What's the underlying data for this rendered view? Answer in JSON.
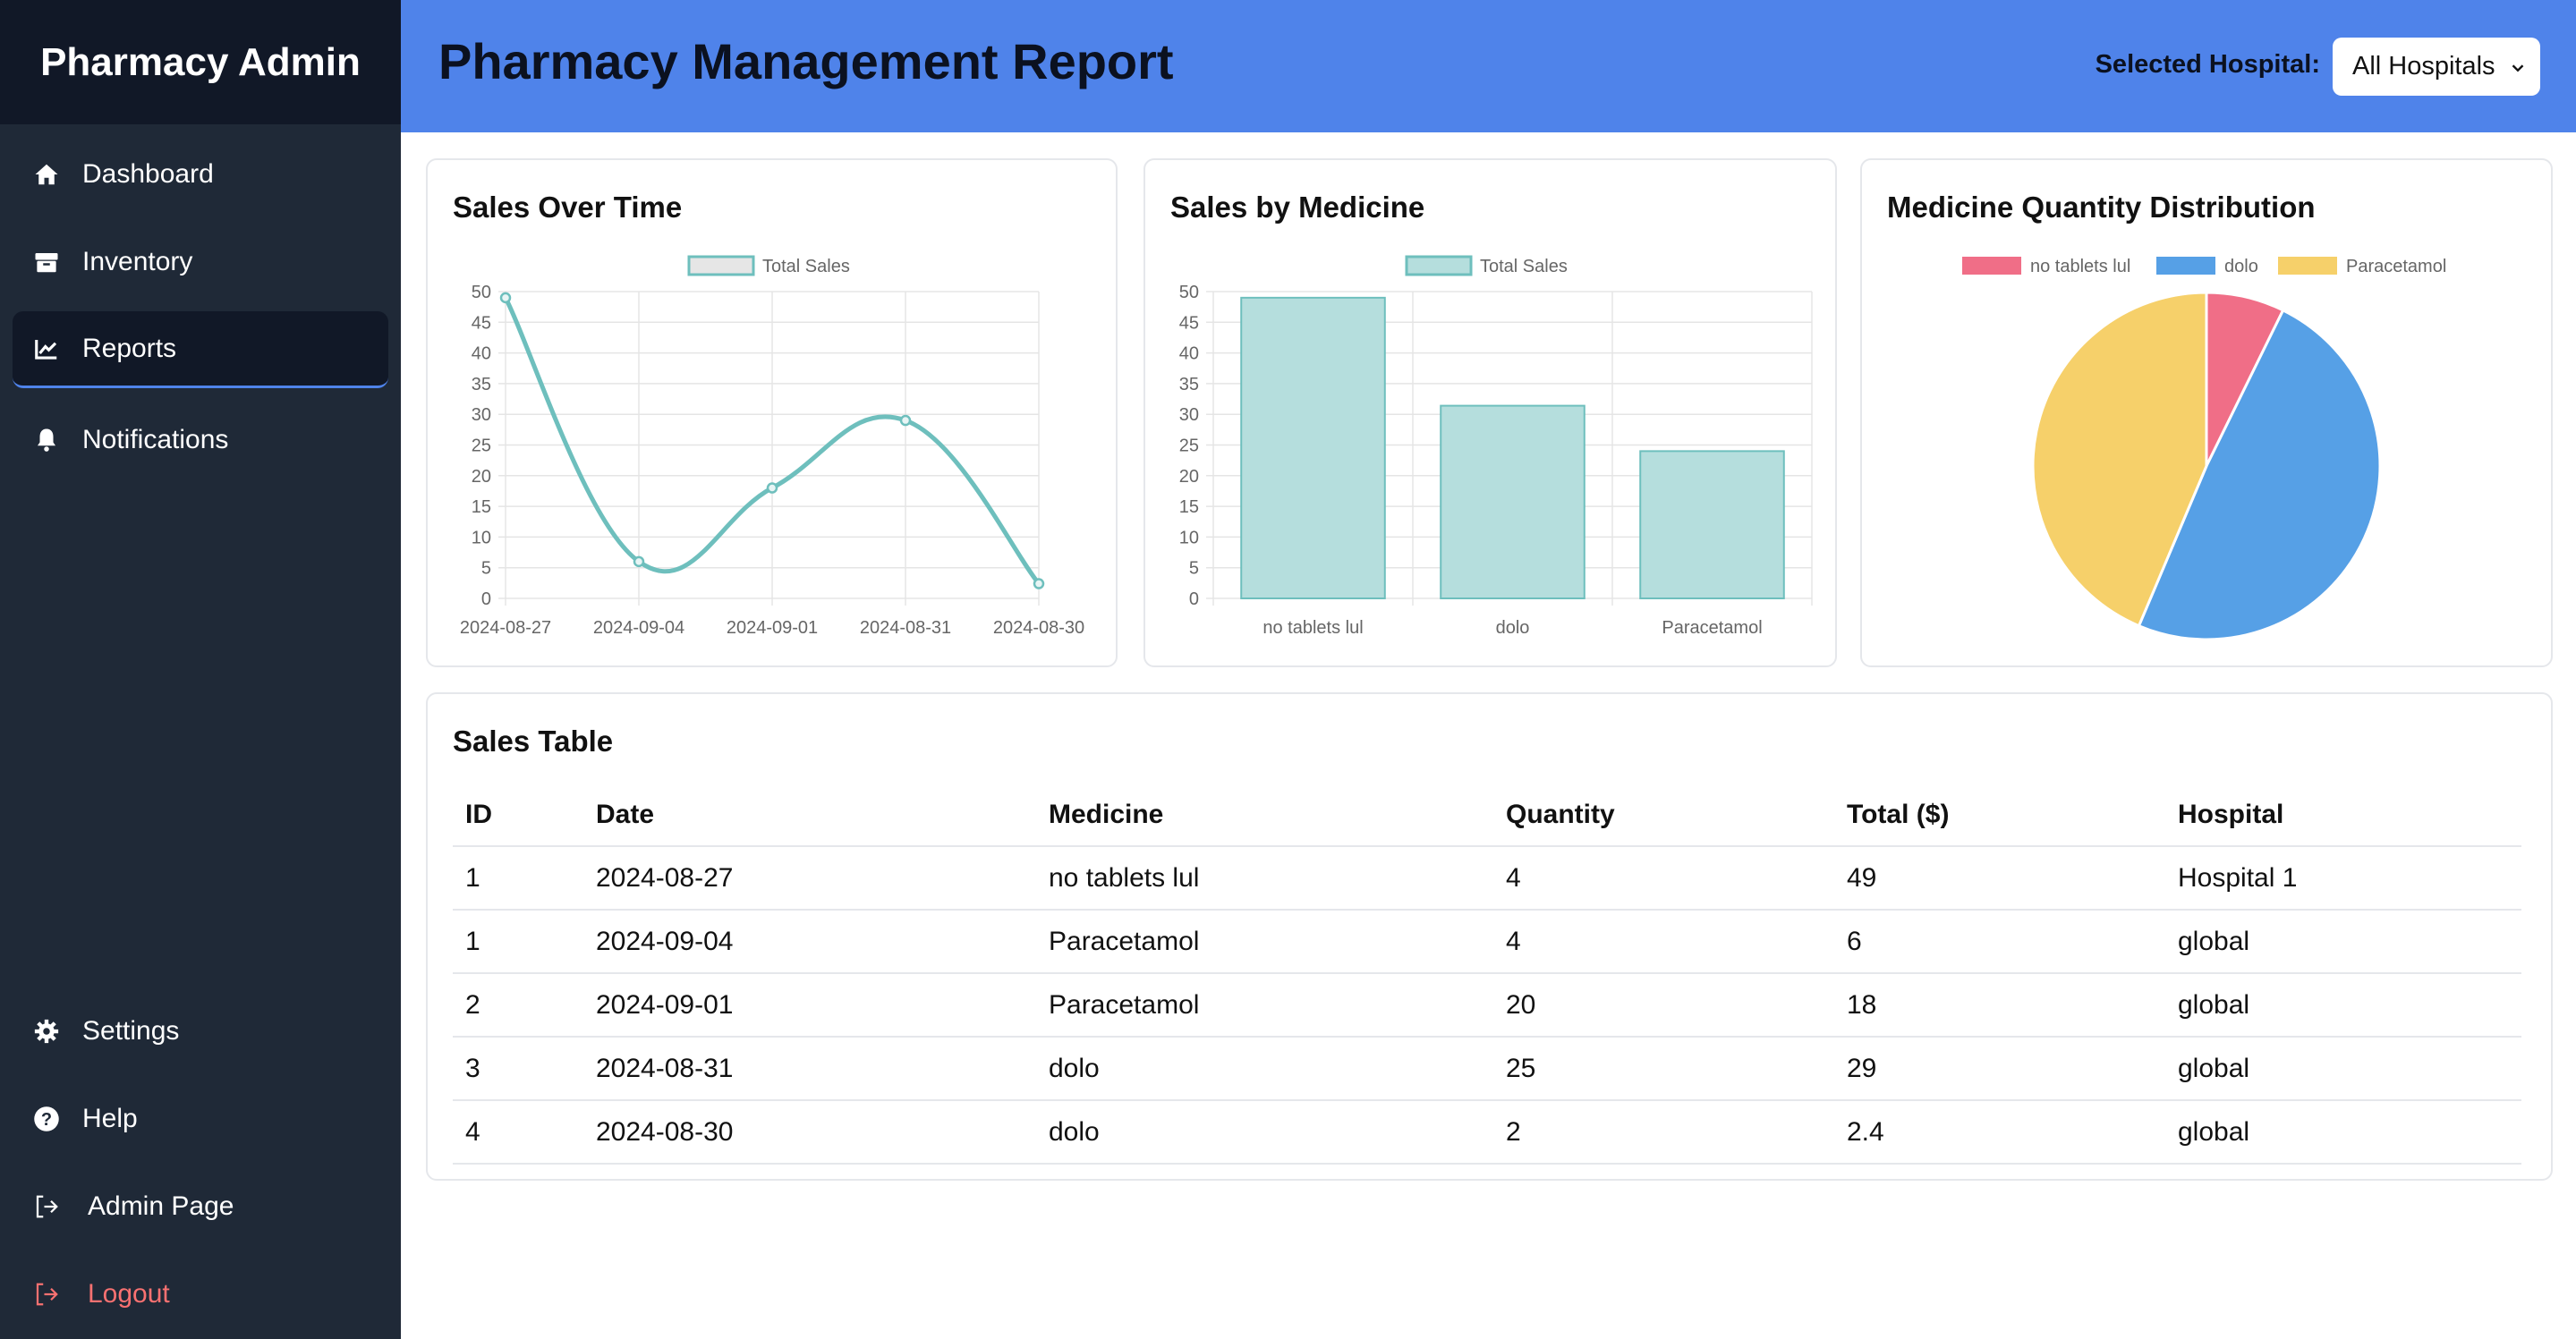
{
  "sidebar": {
    "brand": "Pharmacy Admin",
    "items": [
      {
        "label": "Dashboard",
        "icon": "home-icon"
      },
      {
        "label": "Inventory",
        "icon": "box-icon"
      },
      {
        "label": "Reports",
        "icon": "chart-line-icon",
        "active": true
      },
      {
        "label": "Notifications",
        "icon": "bell-icon"
      }
    ],
    "bottom_items": [
      {
        "label": "Settings",
        "icon": "gear-icon"
      },
      {
        "label": "Help",
        "icon": "question-icon"
      },
      {
        "label": "Admin Page",
        "icon": "sign-in-icon"
      },
      {
        "label": "Logout",
        "icon": "sign-out-icon"
      }
    ]
  },
  "header": {
    "title": "Pharmacy Management Report",
    "hospital_label": "Selected Hospital:",
    "hospital_value": "All Hospitals"
  },
  "colors": {
    "header_bg": "#4f83ea",
    "sidebar_bg": "#1f2937",
    "teal": "#6ebfbd",
    "pie_red": "#f06e87",
    "pie_blue": "#56a0e6",
    "pie_yellow": "#f6d06a",
    "logout": "#f87171"
  },
  "cards": {
    "sales_over_time": "Sales Over Time",
    "sales_by_medicine": "Sales by Medicine",
    "quantity_distribution": "Medicine Quantity Distribution",
    "sales_table": "Sales Table"
  },
  "chart_data": [
    {
      "type": "line",
      "title": "Sales Over Time",
      "categories": [
        "2024-08-27",
        "2024-09-04",
        "2024-09-01",
        "2024-08-31",
        "2024-08-30"
      ],
      "series": [
        {
          "name": "Total Sales",
          "values": [
            49,
            6,
            18,
            29,
            2.4
          ]
        }
      ],
      "ylim": [
        0,
        50
      ],
      "yticks": [
        0,
        5,
        10,
        15,
        20,
        25,
        30,
        35,
        40,
        45,
        50
      ],
      "grid": true,
      "legend": "top-center"
    },
    {
      "type": "bar",
      "title": "Sales by Medicine",
      "categories": [
        "no tablets lul",
        "dolo",
        "Paracetamol"
      ],
      "series": [
        {
          "name": "Total Sales",
          "values": [
            49,
            31.4,
            24
          ]
        }
      ],
      "ylim": [
        0,
        50
      ],
      "yticks": [
        0,
        5,
        10,
        15,
        20,
        25,
        30,
        35,
        40,
        45,
        50
      ],
      "grid": true,
      "legend": "top-center"
    },
    {
      "type": "pie",
      "title": "Medicine Quantity Distribution",
      "categories": [
        "no tablets lul",
        "dolo",
        "Paracetamol"
      ],
      "values": [
        4,
        27,
        24
      ],
      "legend": "top-center"
    }
  ],
  "table": {
    "columns": [
      "ID",
      "Date",
      "Medicine",
      "Quantity",
      "Total ($)",
      "Hospital"
    ],
    "rows": [
      [
        "1",
        "2024-08-27",
        "no tablets lul",
        "4",
        "49",
        "Hospital 1"
      ],
      [
        "1",
        "2024-09-04",
        "Paracetamol",
        "4",
        "6",
        "global"
      ],
      [
        "2",
        "2024-09-01",
        "Paracetamol",
        "20",
        "18",
        "global"
      ],
      [
        "3",
        "2024-08-31",
        "dolo",
        "25",
        "29",
        "global"
      ],
      [
        "4",
        "2024-08-30",
        "dolo",
        "2",
        "2.4",
        "global"
      ]
    ]
  }
}
